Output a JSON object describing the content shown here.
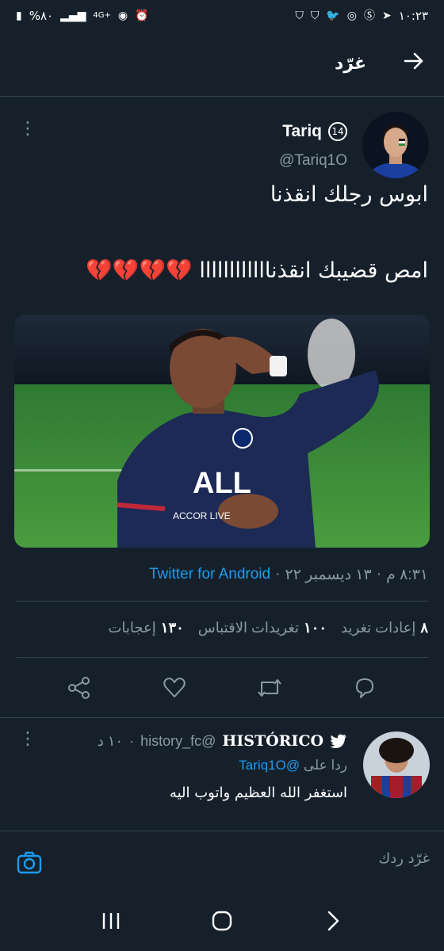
{
  "status_bar": {
    "time": "١٠:٢٣",
    "battery": "%٨٠",
    "network": "4G+",
    "colors": {
      "text": "#ffffff"
    }
  },
  "header": {
    "title": "غرّد",
    "back_icon": "arrow-right-icon"
  },
  "tweet": {
    "name": "Tariq",
    "badge": "14",
    "handle": "@Tariq1O",
    "text_line1": "ابوس رجلك انقذنا",
    "text_line2": "امص قضيبك انقذناااااااااااا",
    "hearts": "💔💔💔💔",
    "meta_time": "٨:٣١ م",
    "meta_date": "١٣ ديسمبر ٢٢",
    "meta_sep": "·",
    "source": "Twitter for Android",
    "stats": {
      "retweets_count": "٨",
      "retweets_label": "إعادات تغريد",
      "quotes_count": "١٠٠",
      "quotes_label": "تغريدات الاقتباس",
      "likes_count": "١٣٠",
      "likes_label": "إعجابات"
    }
  },
  "reply": {
    "name": "HISTÓRICO",
    "handle": "@history_fc",
    "time": "١٠ د",
    "replying_prefix": "ردا على",
    "replying_mention": "@Tariq1O",
    "text": "استغفر الله العظيم واتوب اليه"
  },
  "compose": {
    "placeholder": "غرّد ردك"
  },
  "colors": {
    "background": "#15202b",
    "accent": "#1d9bf0",
    "muted": "#8b98a5",
    "divider": "#38444d",
    "heart": "#e0245e"
  }
}
